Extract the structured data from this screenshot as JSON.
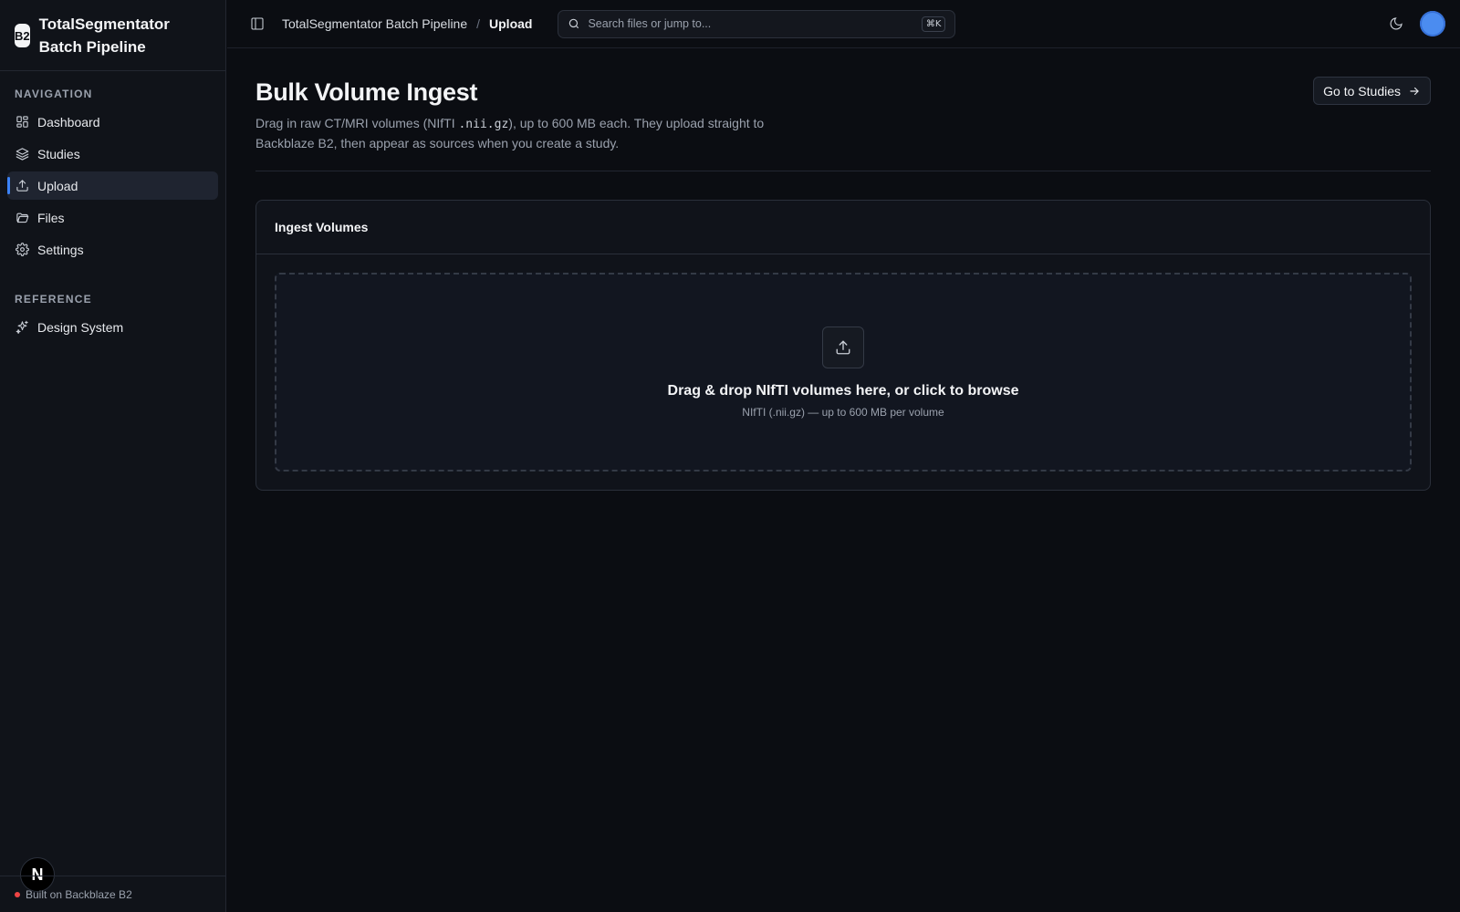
{
  "brand": {
    "logo": "B2",
    "title": "TotalSegmentator Batch Pipeline"
  },
  "sidebar": {
    "sections": [
      {
        "heading": "NAVIGATION"
      },
      {
        "heading": "REFERENCE"
      }
    ],
    "items": [
      {
        "label": "Dashboard",
        "icon": "dashboard-icon"
      },
      {
        "label": "Studies",
        "icon": "layers-icon"
      },
      {
        "label": "Upload",
        "icon": "upload-icon",
        "active": true
      },
      {
        "label": "Files",
        "icon": "folder-icon"
      },
      {
        "label": "Settings",
        "icon": "gear-icon"
      },
      {
        "label": "Design System",
        "icon": "sparkles-icon"
      }
    ],
    "footer": "Built on Backblaze B2",
    "badge": "N"
  },
  "topbar": {
    "breadcrumb": {
      "parent": "TotalSegmentator Batch Pipeline",
      "separator": "/",
      "current": "Upload"
    },
    "search": {
      "placeholder": "Search files or jump to...",
      "shortcut": "⌘K"
    }
  },
  "page": {
    "title": "Bulk Volume Ingest",
    "desc_before": "Drag in raw CT/MRI volumes (NIfTI ",
    "desc_code": ".nii.gz",
    "desc_after": "), up to 600 MB each. They upload straight to Backblaze B2, then appear as sources when you create a study.",
    "action_label": "Go to Studies"
  },
  "card": {
    "title": "Ingest Volumes",
    "dropzone_title": "Drag & drop NIfTI volumes here, or click to browse",
    "dropzone_sub": "NIfTI (.nii.gz) — up to 600 MB per volume"
  },
  "colors": {
    "accent": "#3b82f6",
    "status_dot": "#ef4444",
    "background": "#0b0d12"
  }
}
